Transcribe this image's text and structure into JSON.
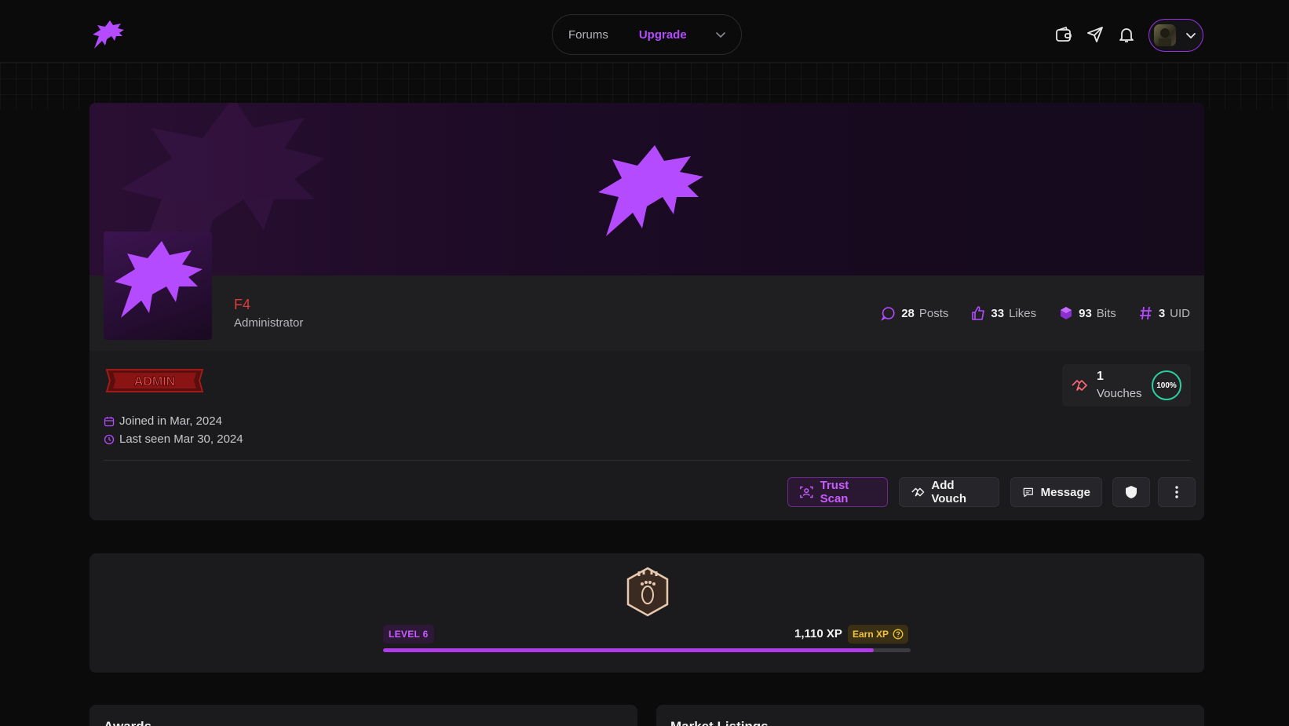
{
  "nav": {
    "forums": "Forums",
    "upgrade": "Upgrade"
  },
  "profile": {
    "username": "F4",
    "role": "Administrator",
    "badge": "ADMIN",
    "joined": "Joined in Mar, 2024",
    "last_seen": "Last seen Mar 30, 2024",
    "stats": [
      {
        "value": "28",
        "label": "Posts",
        "icon": "chat-bubble-icon"
      },
      {
        "value": "33",
        "label": "Likes",
        "icon": "thumbs-up-icon"
      },
      {
        "value": "93",
        "label": "Bits",
        "icon": "bits-gem-icon"
      },
      {
        "value": "3",
        "label": "UID",
        "icon": "hash-icon"
      }
    ],
    "vouches": {
      "count": "1",
      "label": "Vouches",
      "percent": "100%"
    }
  },
  "actions": {
    "trust_scan": "Trust Scan",
    "add_vouch": "Add Vouch",
    "message": "Message"
  },
  "level": {
    "tag": "LEVEL 6",
    "xp": "1,110 XP",
    "earn": "Earn XP",
    "progress_fraction": 0.93
  },
  "sections": {
    "awards": "Awards",
    "market": "Market Listings"
  },
  "colors": {
    "accent": "#b44bff",
    "username": "#e23a3a",
    "vouch_ring": "#2ad1a0",
    "earn_xp": "#f2c23a"
  }
}
